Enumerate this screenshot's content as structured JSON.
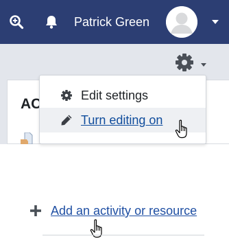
{
  "navbar": {
    "user_name": "Patrick Green",
    "icons": [
      "search-plus-icon",
      "bell-icon",
      "avatar-icon",
      "caret-down-icon"
    ],
    "background": "#2c3e73"
  },
  "course": {
    "title_partial": "AC"
  },
  "settings_menu": {
    "trigger_icon": "gear-icon",
    "items": [
      {
        "label": "Edit settings",
        "icon": "gear-icon"
      },
      {
        "label": "Turn editing on",
        "icon": "pencil-icon",
        "hovered": true
      }
    ]
  },
  "section": {
    "add_activity_label": "Add an activity or resource",
    "add_icon": "plus-icon"
  },
  "colors": {
    "link": "#1f4fa3",
    "menu_hover": "#eef0f3",
    "page_background": "#e3e6ec"
  }
}
